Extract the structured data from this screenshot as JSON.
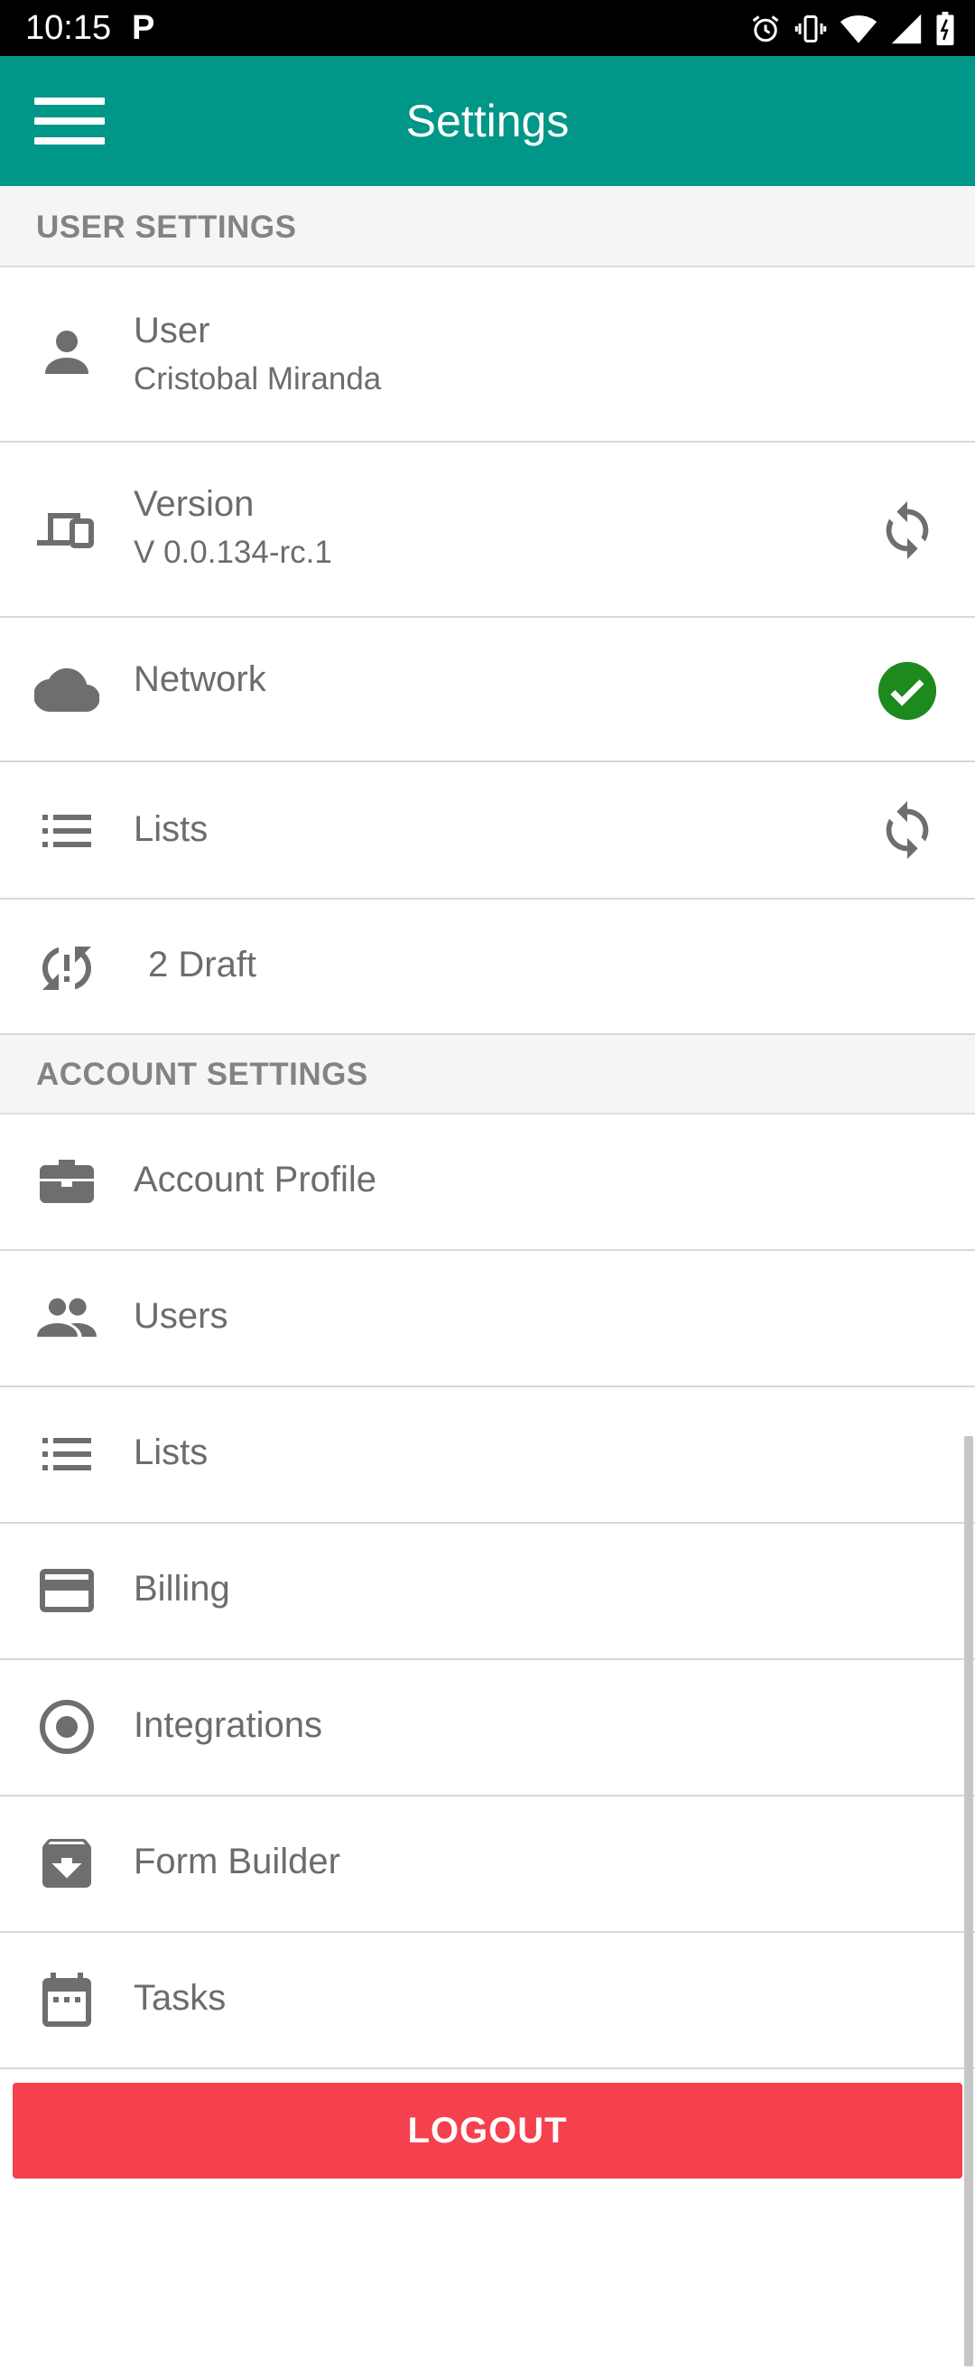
{
  "status_bar": {
    "time": "10:15",
    "app_icon_letter": "P",
    "icons": [
      "alarm-icon",
      "vibrate-icon",
      "wifi-icon",
      "signal-icon",
      "battery-icon"
    ]
  },
  "app_bar": {
    "menu_icon": "hamburger-menu-icon",
    "title": "Settings",
    "color": "#009688"
  },
  "user_settings": {
    "header": "USER SETTINGS",
    "user": {
      "title": "User",
      "subtitle": "Cristobal Miranda",
      "icon": "person-icon"
    },
    "version": {
      "title": "Version",
      "subtitle": "V 0.0.134-rc.1",
      "icon": "devices-icon",
      "action_icon": "sync-icon"
    },
    "network": {
      "title": "Network",
      "icon": "cloud-icon",
      "status_icon": "check-circle-icon",
      "status_color": "#1e8a1e"
    },
    "lists": {
      "title": "Lists",
      "icon": "list-icon",
      "action_icon": "sync-icon"
    },
    "drafts": {
      "title": "2 Draft",
      "icon": "sync-problem-icon"
    }
  },
  "account_settings": {
    "header": "ACCOUNT SETTINGS",
    "items": [
      {
        "title": "Account Profile",
        "icon": "briefcase-icon"
      },
      {
        "title": "Users",
        "icon": "people-icon"
      },
      {
        "title": "Lists",
        "icon": "list-icon"
      },
      {
        "title": "Billing",
        "icon": "credit-card-icon"
      },
      {
        "title": "Integrations",
        "icon": "radio-button-icon"
      },
      {
        "title": "Form Builder",
        "icon": "archive-icon"
      },
      {
        "title": "Tasks",
        "icon": "calendar-icon"
      }
    ]
  },
  "logout": {
    "label": "LOGOUT",
    "color": "#f5404e"
  }
}
